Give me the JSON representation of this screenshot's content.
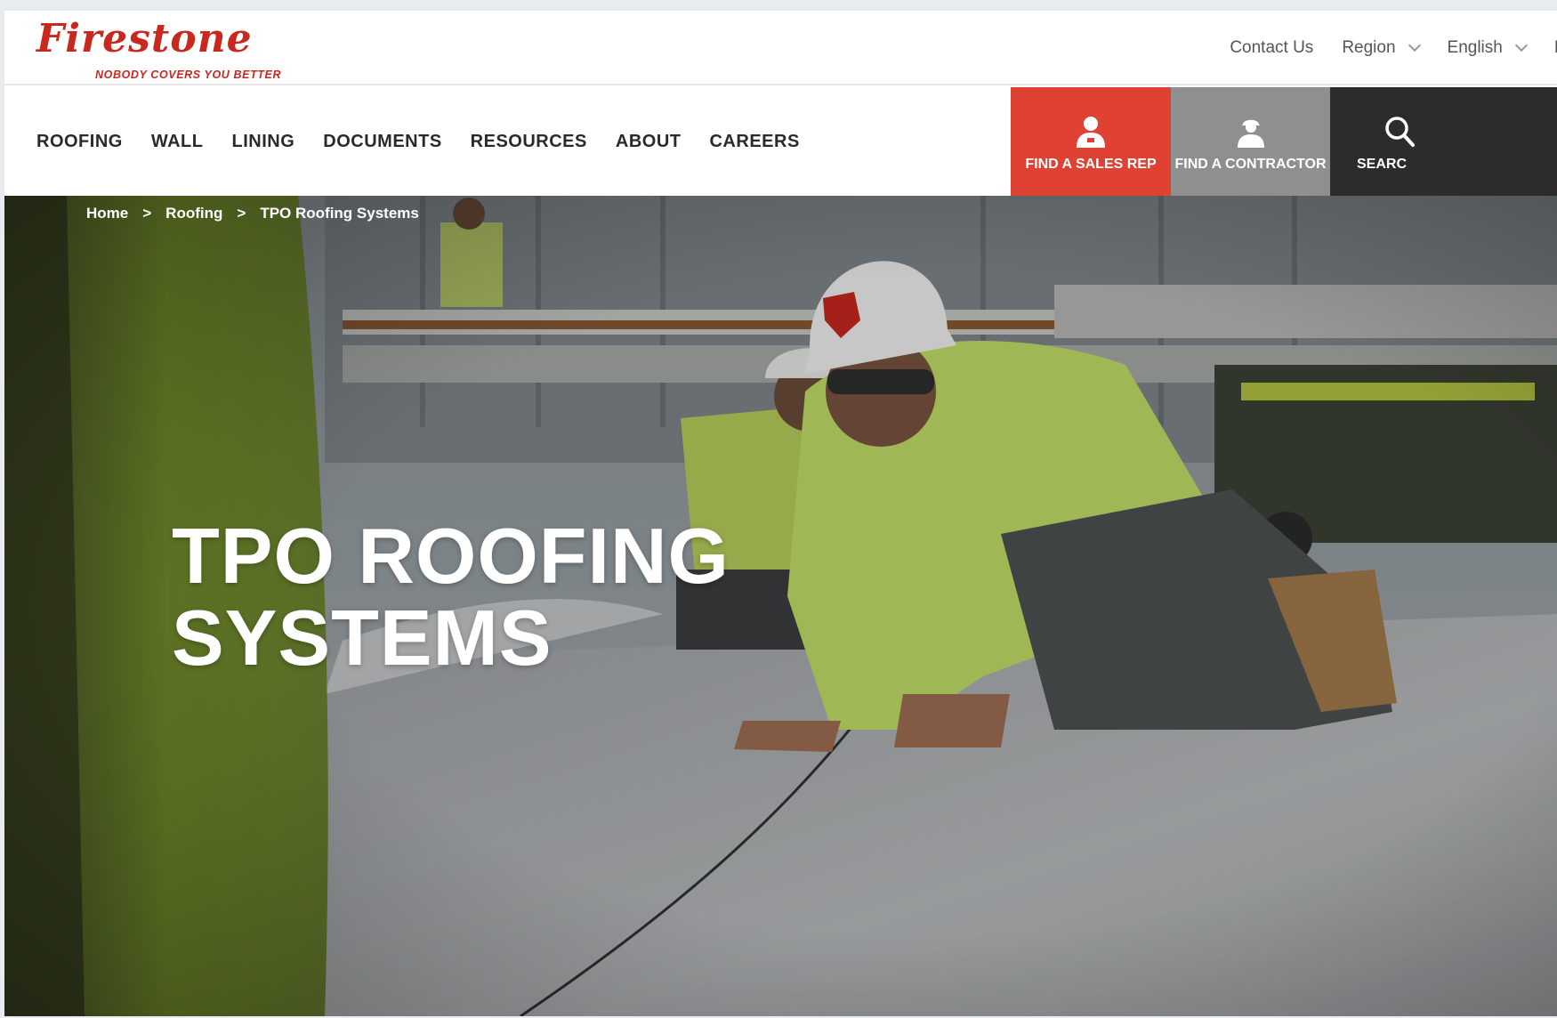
{
  "brand": {
    "name": "Firestone",
    "tagline": "NOBODY COVERS YOU BETTER",
    "brand_color": "#c8281e"
  },
  "utility_nav": {
    "contact_label": "Contact Us",
    "region_label": "Region",
    "language_label": "English",
    "login_label_partial": "Lo"
  },
  "main_nav": {
    "items": [
      {
        "label": "ROOFING"
      },
      {
        "label": "WALL"
      },
      {
        "label": "LINING"
      },
      {
        "label": "DOCUMENTS"
      },
      {
        "label": "RESOURCES"
      },
      {
        "label": "ABOUT"
      },
      {
        "label": "CAREERS"
      }
    ]
  },
  "cta": {
    "sales_rep": {
      "label": "FIND A SALES REP",
      "icon": "person-icon",
      "color": "#df4132"
    },
    "contractor": {
      "label": "FIND A CONTRACTOR",
      "icon": "hardhat-worker-icon",
      "color": "#8f8f8f"
    },
    "search": {
      "label": "SEARC",
      "icon": "search-icon",
      "color": "#2c2c2c"
    }
  },
  "breadcrumb": {
    "items": [
      "Home",
      "Roofing",
      "TPO Roofing Systems"
    ],
    "separator": ">"
  },
  "hero": {
    "title_line1": "TPO ROOFING",
    "title_line2": "SYSTEMS"
  }
}
